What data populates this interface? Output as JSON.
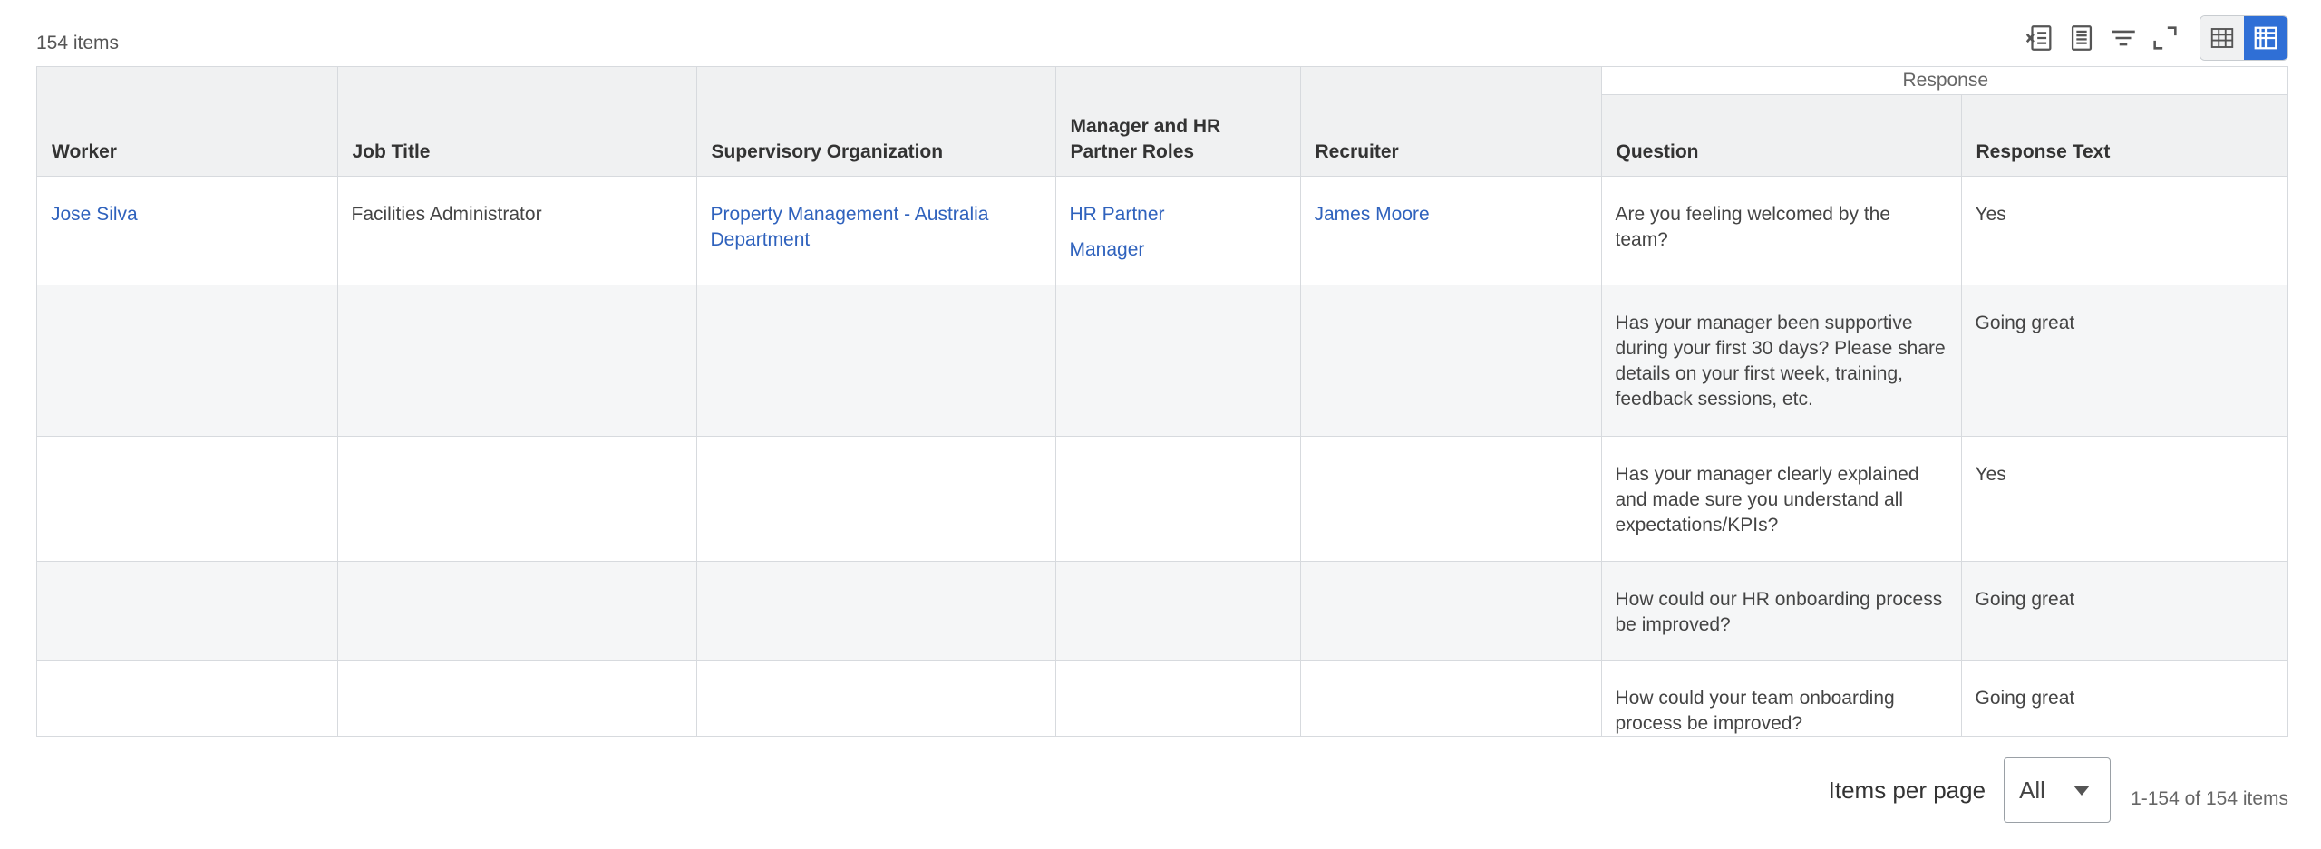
{
  "summary": {
    "count": "154 items"
  },
  "columns": {
    "worker": "Worker",
    "job_title": "Job Title",
    "supervisory_org": "Supervisory Organization",
    "manager_hr": "Manager and HR Partner Roles",
    "recruiter": "Recruiter",
    "response_group": "Response",
    "question": "Question",
    "response_text": "Response Text"
  },
  "rows": [
    {
      "worker": "Jose Silva",
      "job_title": "Facilities Administrator",
      "org": "Property Management - Australia Department",
      "role1": "HR Partner",
      "role2": "Manager",
      "recruiter": "James Moore",
      "question": "Are you feeling welcomed by the team?",
      "response": "Yes"
    },
    {
      "question": "Has your manager been supportive during your first 30 days? Please share details on your first week, training, feedback sessions, etc.",
      "response": "Going great"
    },
    {
      "question": "Has your manager clearly explained and made sure you understand all expectations/KPIs?",
      "response": "Yes"
    },
    {
      "question": "How could our HR onboarding process be improved?",
      "response": "Going great"
    },
    {
      "question": "How could your team onboarding process be improved?",
      "response": "Going great"
    }
  ],
  "pagination": {
    "items_per_page_label": "Items per page",
    "selected": "All",
    "range": "1-154 of 154 items"
  },
  "toolbar": {
    "icons": [
      "export-to-excel-icon",
      "export-to-pdf-icon",
      "filter-icon",
      "fullscreen-icon",
      "table-view-icon",
      "grid-view-icon"
    ]
  },
  "colors": {
    "link": "#2f62bd",
    "active_toggle": "#2f6fd6",
    "header_bg": "#f0f1f2"
  }
}
